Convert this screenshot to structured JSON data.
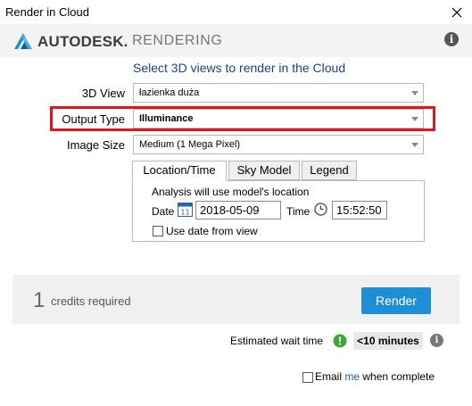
{
  "window": {
    "title": "Render in Cloud"
  },
  "header": {
    "brand": "AUTODESK.",
    "product": "RENDERING",
    "info_glyph": "i"
  },
  "heading": "Select 3D views to render in the Cloud",
  "form": {
    "view": {
      "label": "3D View",
      "value": "łazienka duża"
    },
    "output_type": {
      "label": "Output Type",
      "value": "Illuminance"
    },
    "image_size": {
      "label": "Image Size",
      "value": "Medium (1 Mega Pixel)"
    }
  },
  "tabs": [
    {
      "label": "Location/Time",
      "active": true
    },
    {
      "label": "Sky Model",
      "active": false
    },
    {
      "label": "Legend",
      "active": false
    }
  ],
  "location_panel": {
    "note": "Analysis will use model's location",
    "date_label": "Date",
    "date_value": "2018-05-09",
    "calendar_day": "11",
    "time_label": "Time",
    "time_value": "15:52:50",
    "use_date_label": "Use date from view"
  },
  "credits": {
    "count": "1",
    "text": "credits required"
  },
  "render_button": "Render",
  "wait": {
    "label": "Estimated wait time",
    "value": "<10 minutes",
    "info_glyph": "i"
  },
  "email": {
    "prefix": "Email ",
    "link": "me",
    "suffix": " when complete"
  },
  "colors": {
    "accent": "#1e8fd5",
    "highlight": "#e0161c",
    "heading": "#1c3f94",
    "status_ok": "#3aa935"
  }
}
